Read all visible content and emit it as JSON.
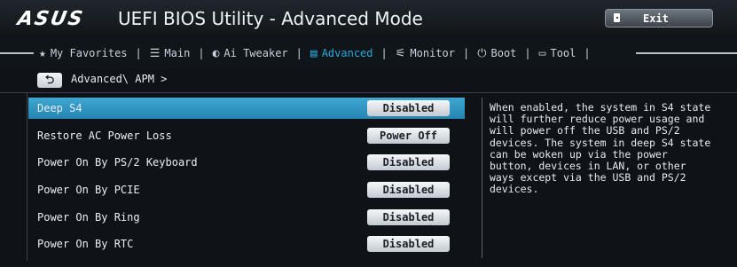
{
  "titlebar": {
    "logo": "ASUS",
    "title": "UEFI BIOS Utility - Advanced Mode",
    "exit_label": "Exit"
  },
  "nav": {
    "items": [
      {
        "label": "My Favorites",
        "icon": "star-icon"
      },
      {
        "label": "Main",
        "icon": "list-icon"
      },
      {
        "label": "Ai Tweaker",
        "icon": "tweaker-icon"
      },
      {
        "label": "Advanced",
        "icon": "advanced-icon",
        "active": true
      },
      {
        "label": "Monitor",
        "icon": "monitor-icon"
      },
      {
        "label": "Boot",
        "icon": "power-icon"
      },
      {
        "label": "Tool",
        "icon": "tool-icon"
      }
    ],
    "active_color": "#2aa7d8"
  },
  "breadcrumb": "Advanced\\ APM >",
  "settings": [
    {
      "label": "Deep S4",
      "value": "Disabled",
      "selected": true
    },
    {
      "label": "Restore AC Power Loss",
      "value": "Power Off"
    },
    {
      "label": "Power On By PS/2 Keyboard",
      "value": "Disabled"
    },
    {
      "label": "Power On By PCIE",
      "value": "Disabled"
    },
    {
      "label": "Power On By Ring",
      "value": "Disabled"
    },
    {
      "label": "Power On By RTC",
      "value": "Disabled"
    }
  ],
  "help": {
    "text": "When enabled, the system in S4 state\nwill further reduce power usage and\nwill power off the USB and PS/2\ndevices. The system in deep S4 state\ncan be woken up via the power\nbutton, devices in LAN, or other\nways except via the USB and PS/2\ndevices."
  },
  "colors": {
    "selected_row": "#3fa7d2",
    "background": "#0f1318"
  }
}
